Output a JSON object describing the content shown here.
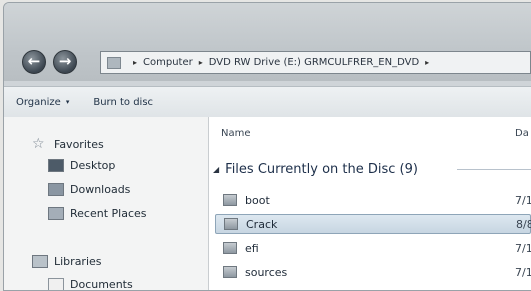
{
  "navigation": {
    "back_glyph": "←",
    "forward_glyph": "→"
  },
  "address_bar": {
    "segments": [
      "Computer",
      "DVD RW Drive (E:) GRMCULFRER_EN_DVD"
    ],
    "separator": "▸"
  },
  "toolbar": {
    "organize_label": "Organize",
    "organize_caret": "▾",
    "burn_label": "Burn to disc"
  },
  "sidebar": {
    "favorites_label": "Favorites",
    "favorites": [
      "Desktop",
      "Downloads",
      "Recent Places"
    ],
    "libraries_label": "Libraries",
    "libraries": [
      "Documents"
    ]
  },
  "columns": {
    "name": "Name",
    "date": "Da"
  },
  "group": {
    "label": "Files Currently on the Disc (9)",
    "toggle": "◢"
  },
  "files": [
    {
      "name": "boot",
      "date": "7/1",
      "selected": false
    },
    {
      "name": "Crack",
      "date": "8/8",
      "selected": true
    },
    {
      "name": "efi",
      "date": "7/1",
      "selected": false
    },
    {
      "name": "sources",
      "date": "7/1",
      "selected": false
    }
  ],
  "colors": {
    "selection_fill": "#c7d6e2",
    "selection_border": "#8ea5b8",
    "toolbar_bg": "#e6ebee"
  }
}
